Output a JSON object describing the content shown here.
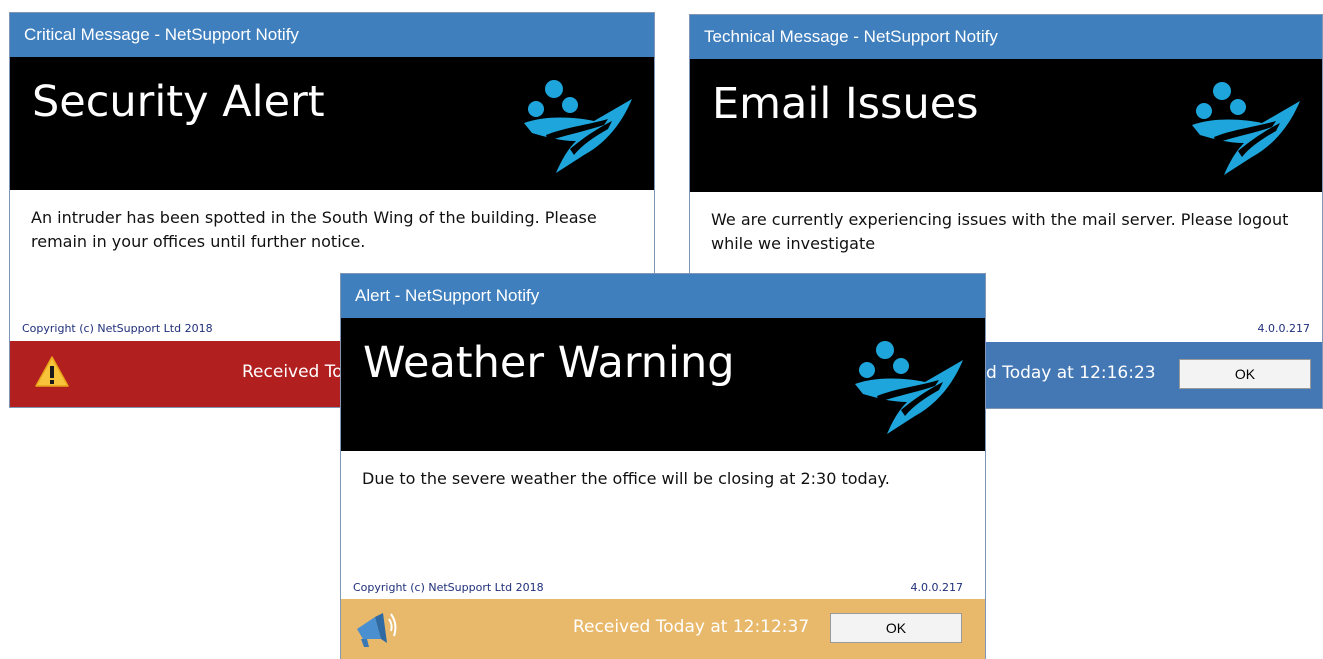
{
  "windows": {
    "critical": {
      "title": "Critical Message - NetSupport Notify",
      "headline": "Security Alert",
      "message": "An intruder has been spotted in the South Wing of the building. Please remain in your offices until further notice.",
      "copyright": "Copyright (c) NetSupport Ltd 2018",
      "received": "Received To",
      "status_icon": "warning-icon",
      "status_color": "#b11f1f"
    },
    "technical": {
      "title": "Technical Message - NetSupport Notify",
      "headline": "Email Issues",
      "message": "We are currently experiencing issues with the mail server. Please logout while we investigate",
      "version": "4.0.0.217",
      "received": "d Today at 12:16:23",
      "ok_label": "OK",
      "status_color": "#4478b4"
    },
    "alert": {
      "title": "Alert - NetSupport Notify",
      "headline": "Weather Warning",
      "message": "Due to the severe weather the office will be closing at 2:30 today.",
      "copyright": "Copyright (c) NetSupport Ltd 2018",
      "version": "4.0.0.217",
      "received": "Received Today at 12:12:37",
      "ok_label": "OK",
      "status_icon": "megaphone-icon",
      "status_color": "#e8b86b"
    }
  },
  "colors": {
    "titlebar": "#3f7fbd",
    "banner": "#000000",
    "logo": "#1ea6dc"
  }
}
